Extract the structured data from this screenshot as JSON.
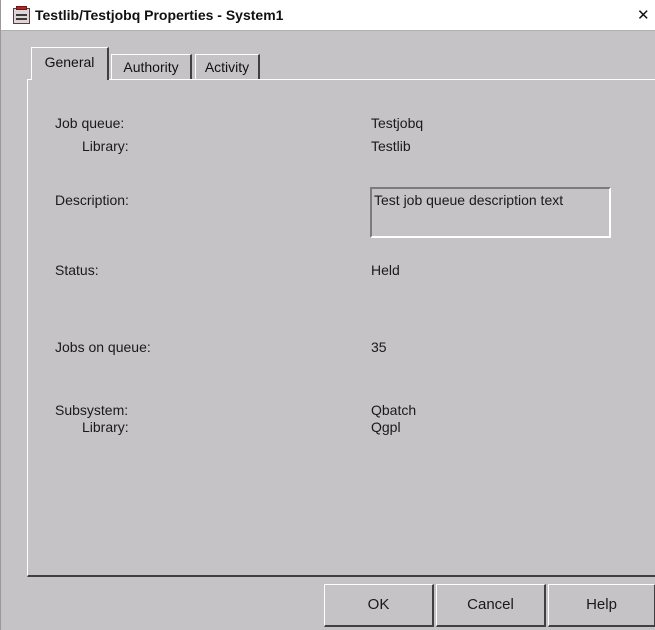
{
  "window": {
    "title": "Testlib/Testjobq Properties - System1",
    "close_glyph": "✕",
    "icon": "system-app-icon"
  },
  "tabs": [
    {
      "label": "General",
      "active": true
    },
    {
      "label": "Authority",
      "active": false
    },
    {
      "label": "Activity",
      "active": false
    }
  ],
  "general": {
    "job_queue_label": "Job queue:",
    "job_queue_value": "Testjobq",
    "library_label": "Library:",
    "library_value": "Testlib",
    "description_label": "Description:",
    "description_value": "Test job queue description text",
    "status_label": "Status:",
    "status_value": "Held",
    "jobs_on_queue_label": "Jobs on queue:",
    "jobs_on_queue_value": "35",
    "subsystem_label": "Subsystem:",
    "subsystem_value": "Qbatch",
    "subsystem_library_label": "Library:",
    "subsystem_library_value": "Qgpl"
  },
  "buttons": {
    "ok": "OK",
    "cancel": "Cancel",
    "help": "Help"
  }
}
